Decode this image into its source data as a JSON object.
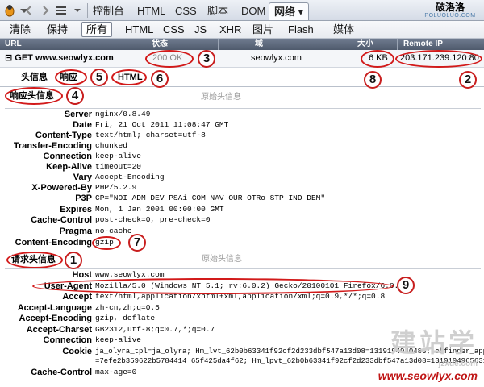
{
  "toolbar": {
    "tabs": [
      "控制台",
      "HTML",
      "CSS",
      "脚本",
      "DOM",
      "网络 ▾"
    ],
    "active_tab": "网络 ▾",
    "logo_cn": "破洛洛",
    "logo_en": "POLUOLUO.COM"
  },
  "filters": {
    "items": [
      "清除",
      "保持",
      "所有",
      "HTML",
      "CSS",
      "JS",
      "XHR",
      "图片",
      "Flash",
      "媒体"
    ],
    "active": "所有"
  },
  "columns": [
    "URL",
    "状态",
    "域",
    "大小",
    "Remote IP"
  ],
  "request": {
    "method_url": "⊟ GET www.seowlyx.com",
    "status": "200 OK",
    "domain": "seowlyx.com",
    "size": "6 KB",
    "remote_ip": "203.171.239.120:80"
  },
  "detail_tabs": [
    "头信息",
    "响应",
    "HTML"
  ],
  "response_headers": {
    "title": "响应头信息",
    "raw_label": "原始头信息",
    "rows": [
      {
        "k": "Server",
        "v": "nginx/0.8.49"
      },
      {
        "k": "Date",
        "v": "Fri, 21 Oct 2011 11:08:47 GMT"
      },
      {
        "k": "Content-Type",
        "v": "text/html; charset=utf-8"
      },
      {
        "k": "Transfer-Encoding",
        "v": "chunked"
      },
      {
        "k": "Connection",
        "v": "keep-alive"
      },
      {
        "k": "Keep-Alive",
        "v": "timeout=20"
      },
      {
        "k": "Vary",
        "v": "Accept-Encoding"
      },
      {
        "k": "X-Powered-By",
        "v": "PHP/5.2.9"
      },
      {
        "k": "P3P",
        "v": "CP=\"NOI ADM DEV PSAi COM NAV OUR OTRo STP IND DEM\""
      },
      {
        "k": "Expires",
        "v": "Mon, 1 Jan 2001 00:00:00 GMT"
      },
      {
        "k": "Cache-Control",
        "v": "post-check=0, pre-check=0"
      },
      {
        "k": "Pragma",
        "v": "no-cache"
      },
      {
        "k": "Content-Encoding",
        "v": "gzip"
      }
    ]
  },
  "request_headers": {
    "title": "请求头信息",
    "raw_label": "原始头信息",
    "rows": [
      {
        "k": "Host",
        "v": "www.seowlyx.com"
      },
      {
        "k": "User-Agent",
        "v": "Mozilla/5.0 (Windows NT 5.1; rv:6.0.2) Gecko/20100101 Firefox/6.0.2"
      },
      {
        "k": "Accept",
        "v": "text/html,application/xhtml+xml,application/xml;q=0.9,*/*;q=0.8"
      },
      {
        "k": "Accept-Language",
        "v": "zh-cn,zh;q=0.5"
      },
      {
        "k": "Accept-Encoding",
        "v": "gzip, deflate"
      },
      {
        "k": "Accept-Charset",
        "v": "GB2312,utf-8;q=0.7,*;q=0.7"
      },
      {
        "k": "Connection",
        "v": "keep-alive"
      },
      {
        "k": "Cookie",
        "v": "ja_olyra_tpl=ja_olyra; Hm_lvt_62b0b63341f92cf2d233dbf547a13d08=1319194940483; ckfinder_app"
      },
      {
        "k": "Cache-Control",
        "v": "max-age=0"
      }
    ],
    "cookie_line2": "=7efe2b359622b5784414 65f425da4f62; Hm_lpvt_62b0b63341f92cf2d233dbf547a13d08=1319194965631"
  },
  "annotations": [
    "1",
    "2",
    "3",
    "4",
    "5",
    "6",
    "7",
    "8",
    "9"
  ],
  "watermark": {
    "big": "建站学",
    "jz": "jzxue.com",
    "url": "www.seowlyx.com"
  },
  "colors": {
    "accent_red": "#d21a1a",
    "header_bar": "#5a667a"
  }
}
